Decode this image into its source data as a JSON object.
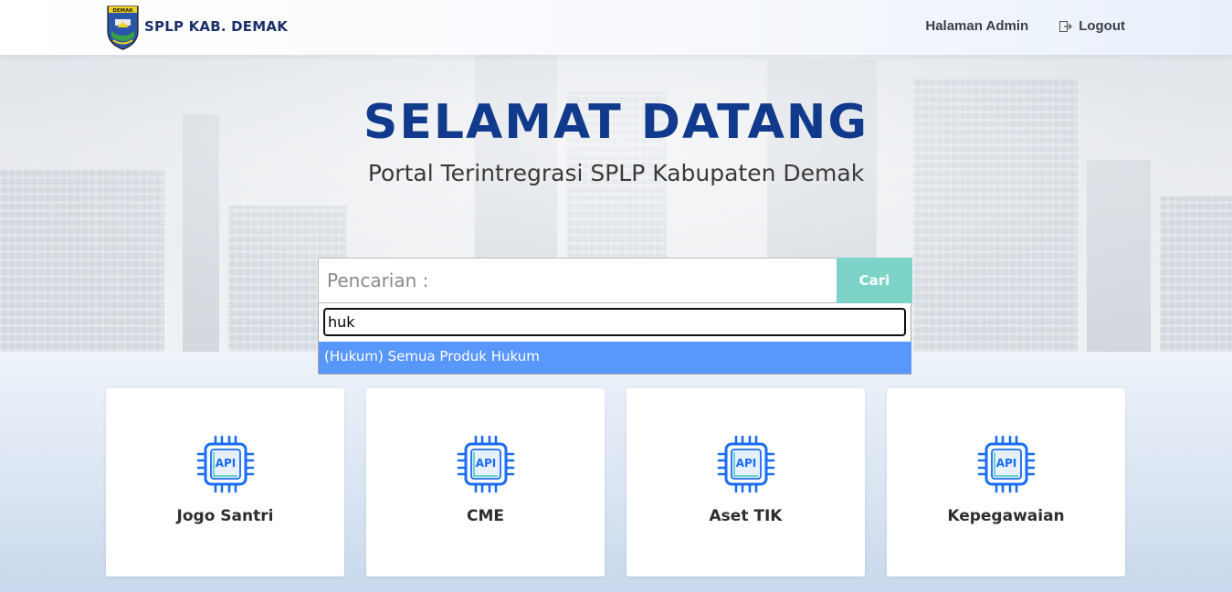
{
  "navbar": {
    "brand": "SPLP KAB. DEMAK",
    "logo_text": "DEMAK",
    "links": [
      {
        "label": "Halaman Admin"
      },
      {
        "label": "Logout",
        "icon": "logout-icon"
      }
    ]
  },
  "hero": {
    "title": "SELAMAT DATANG",
    "subtitle": "Portal Terintregrasi SPLP Kabupaten Demak"
  },
  "search": {
    "placeholder": "Pencarian :",
    "button_label": "Cari",
    "dropdown_value": "huk",
    "options": [
      {
        "label": "(Hukum) Semua Produk Hukum",
        "highlighted": true
      }
    ]
  },
  "cards": [
    {
      "label": "Jogo Santri",
      "icon": "api-chip-icon",
      "icon_text": "API"
    },
    {
      "label": "CME",
      "icon": "api-chip-icon",
      "icon_text": "API"
    },
    {
      "label": "Aset TIK",
      "icon": "api-chip-icon",
      "icon_text": "API"
    },
    {
      "label": "Kepegawaian",
      "icon": "api-chip-icon",
      "icon_text": "API"
    }
  ],
  "colors": {
    "title": "#123a8c",
    "button": "#7dd3c8",
    "highlight": "#5897fb",
    "icon_blue": "#1a6cf0"
  }
}
